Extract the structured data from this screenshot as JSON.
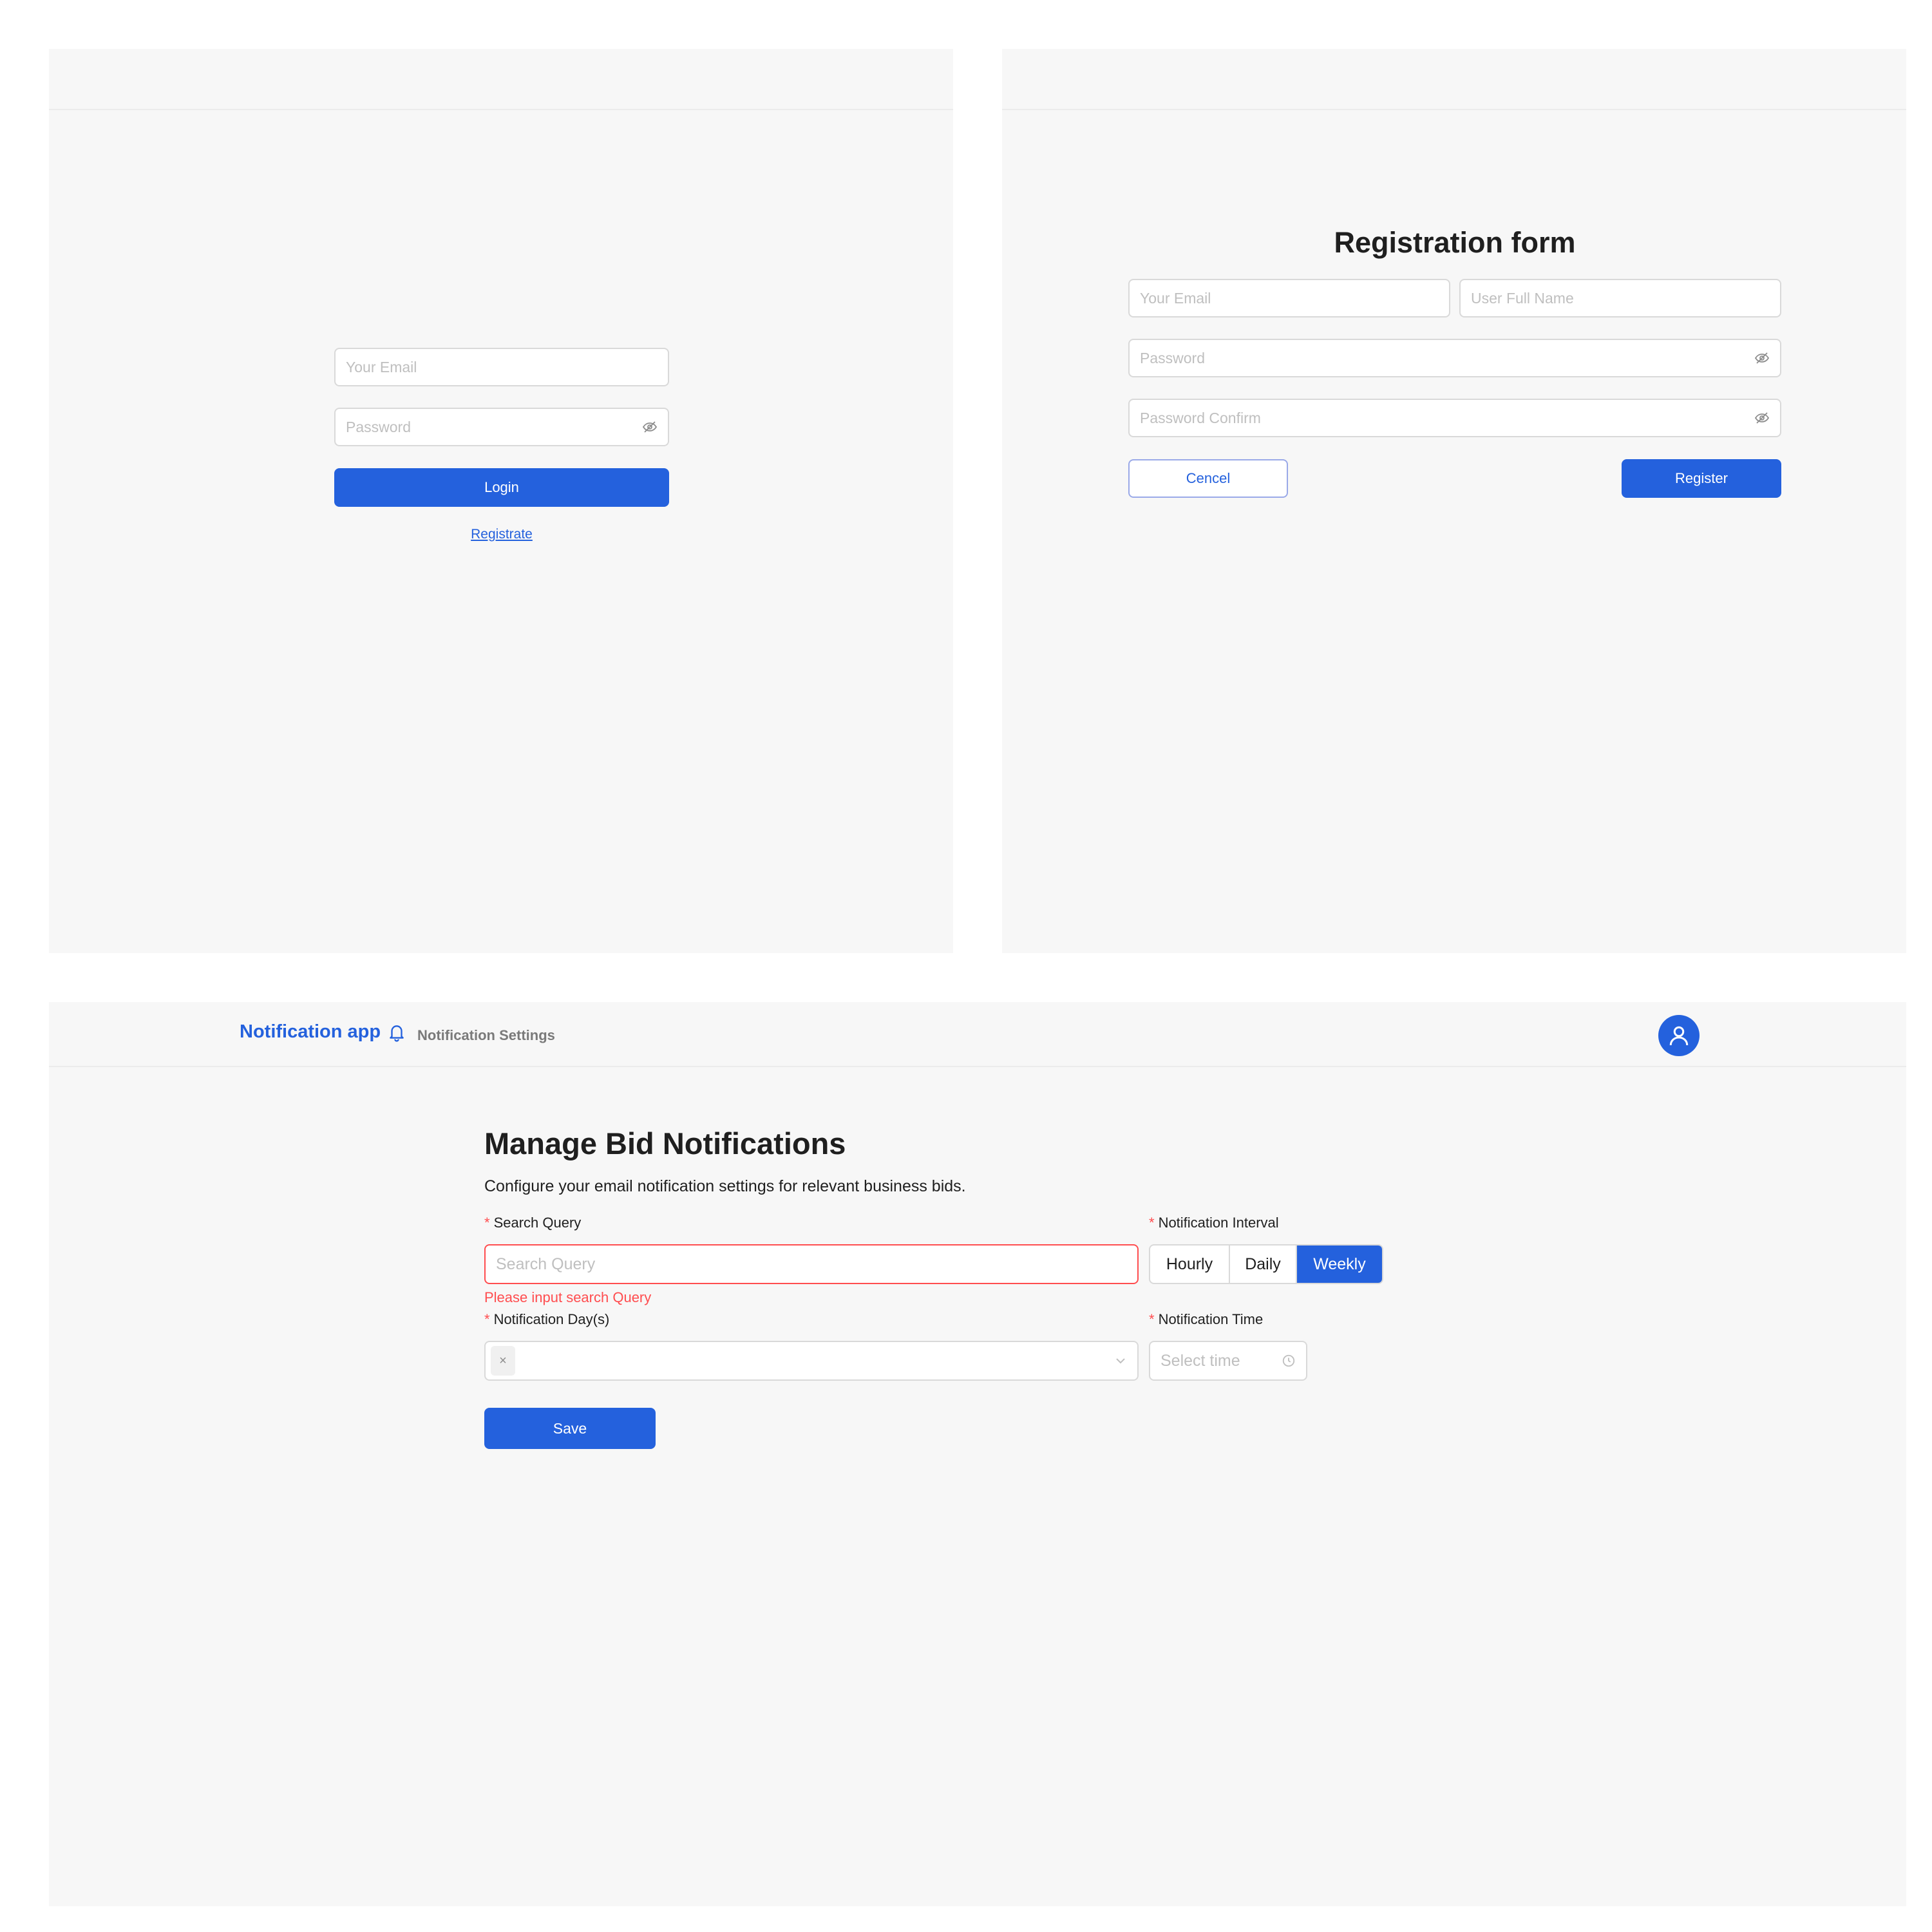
{
  "login": {
    "email_placeholder": "Your Email",
    "password_placeholder": "Password",
    "login_label": "Login",
    "register_link": "Registrate"
  },
  "registration": {
    "title": "Registration form",
    "email_placeholder": "Your Email",
    "fullname_placeholder": "User Full Name",
    "password_placeholder": "Password",
    "password_confirm_placeholder": "Password Confirm",
    "cancel_label": "Cencel",
    "register_label": "Register"
  },
  "app": {
    "brand": "Notification app",
    "nav": {
      "settings": "Notification Settings"
    },
    "page": {
      "title": "Manage Bid Notifications",
      "description": "Configure your email notification settings for relevant business bids.",
      "search_label": "Search Query",
      "search_placeholder": "Search Query",
      "search_error": "Please input search Query",
      "interval_label": "Notification Interval",
      "interval_options": [
        "Hourly",
        "Daily",
        "Weekly"
      ],
      "interval_selected": "Weekly",
      "days_label": "Notification Day(s)",
      "days_tag_remove": "×",
      "time_label": "Notification Time",
      "time_placeholder": "Select time",
      "save_label": "Save",
      "required_mark": "*"
    }
  },
  "colors": {
    "accent": "#2461dd",
    "error": "#ff4d4f",
    "panel_bg": "#f7f7f7",
    "border": "#d9d9d9"
  }
}
